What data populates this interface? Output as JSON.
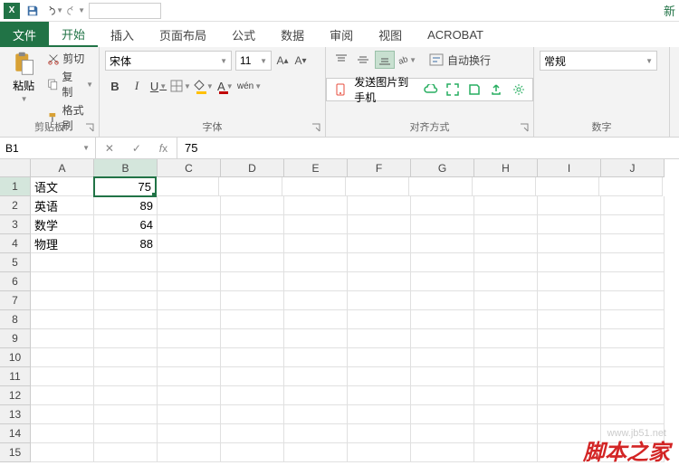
{
  "titlebar": {
    "right_label": "新"
  },
  "tabs": {
    "file": "文件",
    "items": [
      "开始",
      "插入",
      "页面布局",
      "公式",
      "数据",
      "审阅",
      "视图",
      "ACROBAT"
    ],
    "active": 0
  },
  "ribbon": {
    "clipboard": {
      "paste": "粘贴",
      "cut": "剪切",
      "copy": "复制",
      "painter": "格式刷",
      "label": "剪贴板"
    },
    "font": {
      "name": "宋体",
      "size": "11",
      "label": "字体"
    },
    "align": {
      "wrap": "自动换行",
      "label": "对齐方式",
      "float": "发送图片到手机"
    },
    "number": {
      "format": "常规",
      "label": "数字"
    }
  },
  "namebox": "B1",
  "formula": "75",
  "columns": [
    "A",
    "B",
    "C",
    "D",
    "E",
    "F",
    "G",
    "H",
    "I",
    "J"
  ],
  "selected_col": 1,
  "selected_row": 0,
  "row_count": 15,
  "cells": [
    {
      "r": 0,
      "c": 0,
      "v": "语文",
      "num": false
    },
    {
      "r": 0,
      "c": 1,
      "v": "75",
      "num": true
    },
    {
      "r": 1,
      "c": 0,
      "v": "英语",
      "num": false
    },
    {
      "r": 1,
      "c": 1,
      "v": "89",
      "num": true
    },
    {
      "r": 2,
      "c": 0,
      "v": "数学",
      "num": false
    },
    {
      "r": 2,
      "c": 1,
      "v": "64",
      "num": true
    },
    {
      "r": 3,
      "c": 0,
      "v": "物理",
      "num": false
    },
    {
      "r": 3,
      "c": 1,
      "v": "88",
      "num": true
    }
  ],
  "watermark": "脚本之家",
  "watermark2": "www.jb51.net"
}
